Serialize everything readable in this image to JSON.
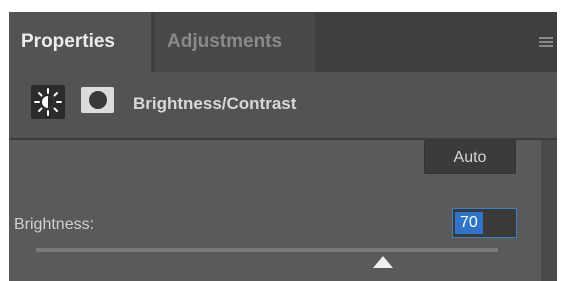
{
  "tabs": {
    "properties_label": "Properties",
    "adjustments_label": "Adjustments"
  },
  "adjustment": {
    "title": "Brightness/Contrast",
    "icon_name": "sun-icon",
    "mask_icon_name": "layer-mask-icon"
  },
  "controls": {
    "auto_label": "Auto",
    "brightness_label": "Brightness:",
    "brightness_value": "70",
    "brightness_fraction": 0.75
  },
  "colors": {
    "panel_bg": "#535353",
    "field_highlight": "#2f74c6"
  }
}
